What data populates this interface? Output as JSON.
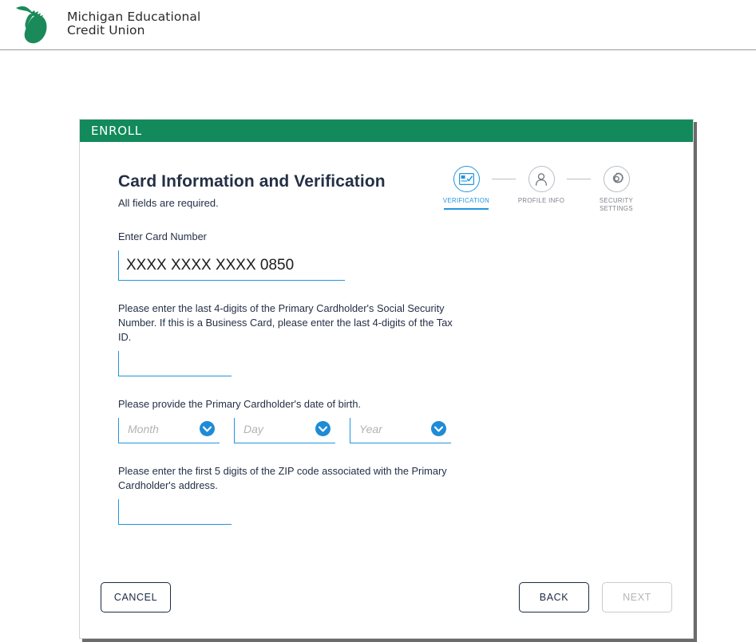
{
  "header": {
    "brand_name": "Michigan Educational\nCredit Union",
    "logo_icon": "michigan-state-outline",
    "brand_color": "#1b8a5a"
  },
  "card": {
    "header_title": "ENROLL",
    "header_color": "#128a5c"
  },
  "form": {
    "title": "Card Information and Verification",
    "subtitle": "All fields are required.",
    "card_number": {
      "label": "Enter Card Number",
      "value": "XXXX XXXX XXXX 0850",
      "placeholder": ""
    },
    "ssn": {
      "label": "Please enter the last 4-digits of the Primary Cardholder's Social Security Number. If this is a Business Card, please enter the last 4-digits of the Tax ID.",
      "value": "",
      "placeholder": ""
    },
    "dob": {
      "label": "Please provide the Primary Cardholder's date of birth.",
      "month_placeholder": "Month",
      "day_placeholder": "Day",
      "year_placeholder": "Year",
      "month_value": "",
      "day_value": "",
      "year_value": "",
      "chevron_icon": "chevron-down-icon"
    },
    "zip": {
      "label": "Please enter the first 5 digits of the ZIP code associated with the Primary Cardholder's address.",
      "value": "",
      "placeholder": ""
    }
  },
  "steps": {
    "accent_color": "#2196dd",
    "inactive_color": "#7d838c",
    "items": [
      {
        "label": "VERIFICATION",
        "icon": "card-check-icon",
        "active": true
      },
      {
        "label": "PROFILE INFO",
        "icon": "person-icon",
        "active": false
      },
      {
        "label": "SECURITY\nSETTINGS",
        "icon": "gear-icon",
        "active": false
      }
    ]
  },
  "buttons": {
    "cancel_label": "CANCEL",
    "back_label": "BACK",
    "next_label": "NEXT",
    "next_disabled": true
  }
}
